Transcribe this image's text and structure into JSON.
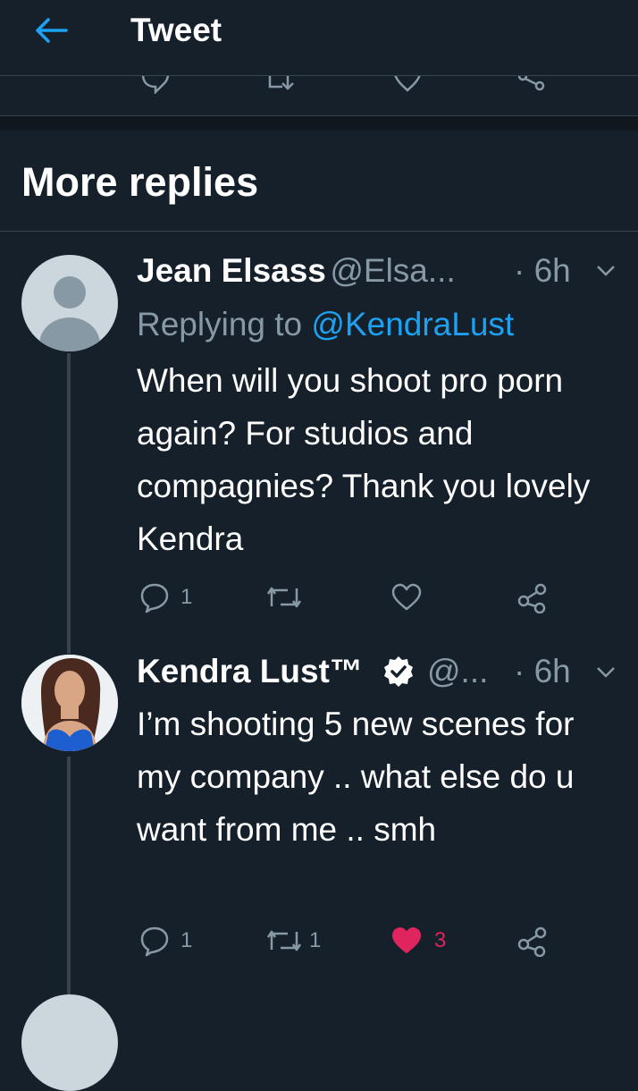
{
  "header": {
    "title": "Tweet"
  },
  "section": {
    "title": "More replies"
  },
  "replies": [
    {
      "name": "Jean Elsass",
      "handle": "@Elsa...",
      "time": "· 6h",
      "replying_prefix": "Replying to ",
      "replying_to": "@KendraLust",
      "text": "When will you shoot pro porn again? For studios and compagnies? Thank you lovely Kendra",
      "reply_count": "1",
      "retweet_count": "",
      "like_count": ""
    },
    {
      "name": "Kendra Lust™",
      "handle": "@...",
      "time": "· 6h",
      "text": "I’m shooting 5 new scenes for my company ..  what else do u want from me .. smh",
      "reply_count": "1",
      "retweet_count": "1",
      "like_count": "3",
      "liked": true
    }
  ],
  "colors": {
    "background": "#15202b",
    "accent": "#1da1f2",
    "muted": "#8899a6",
    "like": "#e0245e",
    "verified": "#ffffff"
  },
  "icons": [
    "back-arrow-icon",
    "reply-icon",
    "retweet-icon",
    "like-icon",
    "share-icon",
    "verified-badge-icon",
    "chevron-down-icon"
  ]
}
